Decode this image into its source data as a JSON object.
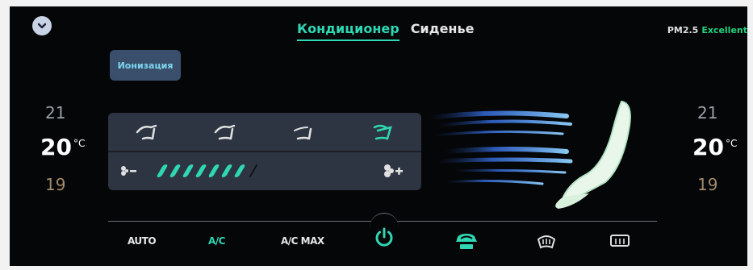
{
  "header": {
    "tabs": [
      {
        "label": "Кондиционер",
        "active": true
      },
      {
        "label": "Сиденье",
        "active": false
      }
    ],
    "pm_label": "PM2.5",
    "pm_status": "Excellent"
  },
  "ionization_label": "Ионизация",
  "left_temp": {
    "up": "21",
    "current": "20",
    "unit": "°C",
    "down": "19"
  },
  "right_temp": {
    "up": "21",
    "current": "20",
    "unit": "°C",
    "down": "19"
  },
  "fan": {
    "level": 7,
    "max": 8
  },
  "bottom": {
    "auto": "AUTO",
    "ac": "A/C",
    "ac_max": "A/C MAX"
  },
  "colors": {
    "accent": "#2fd7b3",
    "pm_good": "#20d27e",
    "panel": "#2d3442",
    "ionization": "#3a4f6b"
  },
  "icons": [
    "chevron-down-icon",
    "airflow-face-icon",
    "airflow-face-feet-icon",
    "airflow-feet-icon",
    "airflow-windshield-icon",
    "fan-minus-icon",
    "fan-plus-icon",
    "power-icon",
    "recirculation-icon",
    "front-defrost-icon",
    "rear-defrost-icon"
  ]
}
